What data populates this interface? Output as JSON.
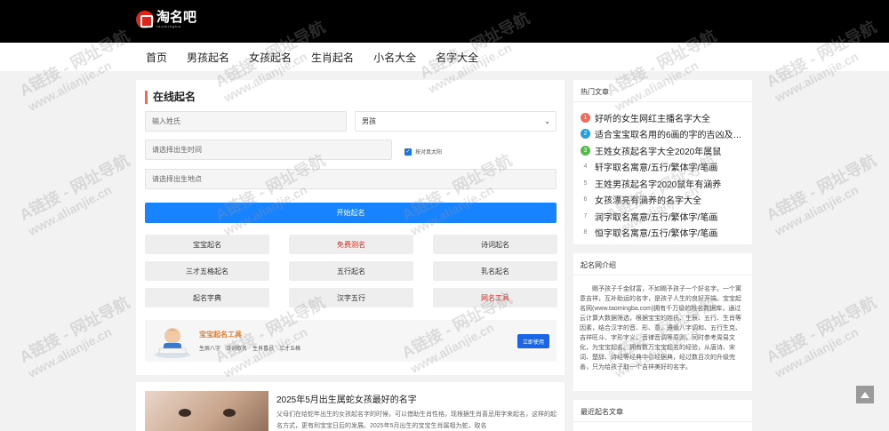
{
  "header": {
    "logo_text": "淘名吧",
    "logo_sub": "taomingba"
  },
  "nav": [
    "首页",
    "男孩起名",
    "女孩起名",
    "生肖起名",
    "小名大全",
    "名字大全"
  ],
  "form": {
    "title": "在线起名",
    "surname_placeholder": "输入姓氏",
    "gender_value": "男孩",
    "birth_time_placeholder": "请选择出生时间",
    "true_solar_label": "按对真太阳",
    "birth_place_placeholder": "请选择出生地点",
    "start_button": "开始起名"
  },
  "tools": [
    {
      "label": "宝宝起名",
      "red": false
    },
    {
      "label": "免费测名",
      "red": true
    },
    {
      "label": "诗词起名",
      "red": false
    },
    {
      "label": "三才五格起名",
      "red": false
    },
    {
      "label": "五行起名",
      "red": false
    },
    {
      "label": "乳名起名",
      "red": false
    },
    {
      "label": "起名字典",
      "red": false
    },
    {
      "label": "汉字五行",
      "red": false
    },
    {
      "label": "网名工具",
      "red": true
    }
  ],
  "promo": {
    "title": "宝宝起名工具",
    "tags": [
      "生辰八字",
      "诗词取名",
      "生肖喜忌",
      "三才五格"
    ],
    "button": "立即使用"
  },
  "article": {
    "title": "2025年5月出生属蛇女孩最好的名字",
    "text": "父母们在给蛇年出生的女孩起名字的时候，可以借助生肖性格，现根据生肖喜忌用字来起名，这样的起名方式，更有利宝宝日后的发展。2025年5月出生的宝宝生肖属相为蛇，取名"
  },
  "hot": {
    "title": "热门文章",
    "items": [
      {
        "num": "1",
        "text": "好听的女生网红主播名字大全"
      },
      {
        "num": "2",
        "text": "适合宝宝取名用的6画的字的吉凶及…"
      },
      {
        "num": "3",
        "text": "王姓女孩起名字大全2020年属鼠"
      },
      {
        "num": "4",
        "text": "轩字取名寓意/五行/繁体字/笔画"
      },
      {
        "num": "5",
        "text": "王姓男孩起名字2020鼠年有涵养"
      },
      {
        "num": "6",
        "text": "女孩漂亮有涵养的名字大全"
      },
      {
        "num": "7",
        "text": "润字取名寓意/五行/繁体字/笔画"
      },
      {
        "num": "8",
        "text": "恒字取名寓意/五行/繁体字/笔画"
      }
    ],
    "badge_colors": [
      "#f26a5a",
      "#2a9be0",
      "#52b94a"
    ]
  },
  "intro": {
    "title": "起名网介绍",
    "text": "赐予孩子千金财富，不如赐予孩子一个好名字。一个寓意吉祥，互补助运的名字，是孩子人生的良好开端。宝宝起名网(www.taomingba.com)拥有千万级的姓名数据库，通过云计算大数据筛选，根据宝宝的姓氏、生辰、五行、生肖等因素，结合汉字的音、形、意，遵循八字调和、五行生克、吉祥旺斗、字形字义、音律音调等原则，同时参考周易文化，为宝宝起名。拥有数万宝宝起名的经验，从唐诗、宋词、楚辞、诗经等经典中引经据典，经过数百次的升级完善，只为给孩子取一个吉祥美好的名字。"
  },
  "recent": {
    "title": "最近起名文章"
  },
  "watermark": {
    "line1": "A链接 - 网址导航",
    "line2": "www.alianjie.cn"
  }
}
